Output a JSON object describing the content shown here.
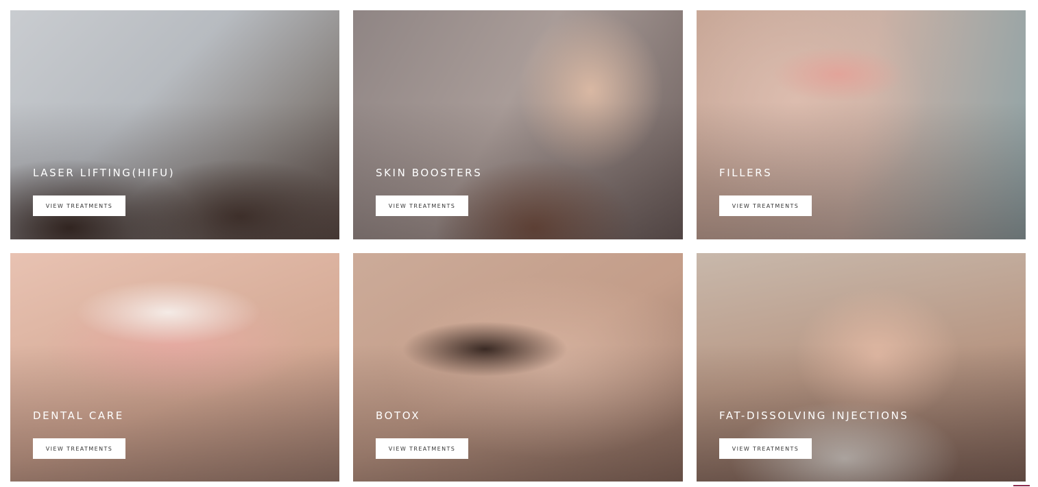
{
  "cards": [
    {
      "title": "LASER LIFTING(HIFU)",
      "button": "VIEW TREATMENTS"
    },
    {
      "title": "SKIN BOOSTERS",
      "button": "VIEW TREATMENTS"
    },
    {
      "title": "FILLERS",
      "button": "VIEW TREATMENTS"
    },
    {
      "title": "DENTAL CARE",
      "button": "VIEW TREATMENTS"
    },
    {
      "title": "BOTOX",
      "button": "VIEW TREATMENTS"
    },
    {
      "title": "FAT-DISSOLVING INJECTIONS",
      "button": "VIEW TREATMENTS"
    }
  ],
  "colors": {
    "button_bg": "#ffffff",
    "title_text": "#ffffff",
    "accent": "#8e2a4d"
  }
}
